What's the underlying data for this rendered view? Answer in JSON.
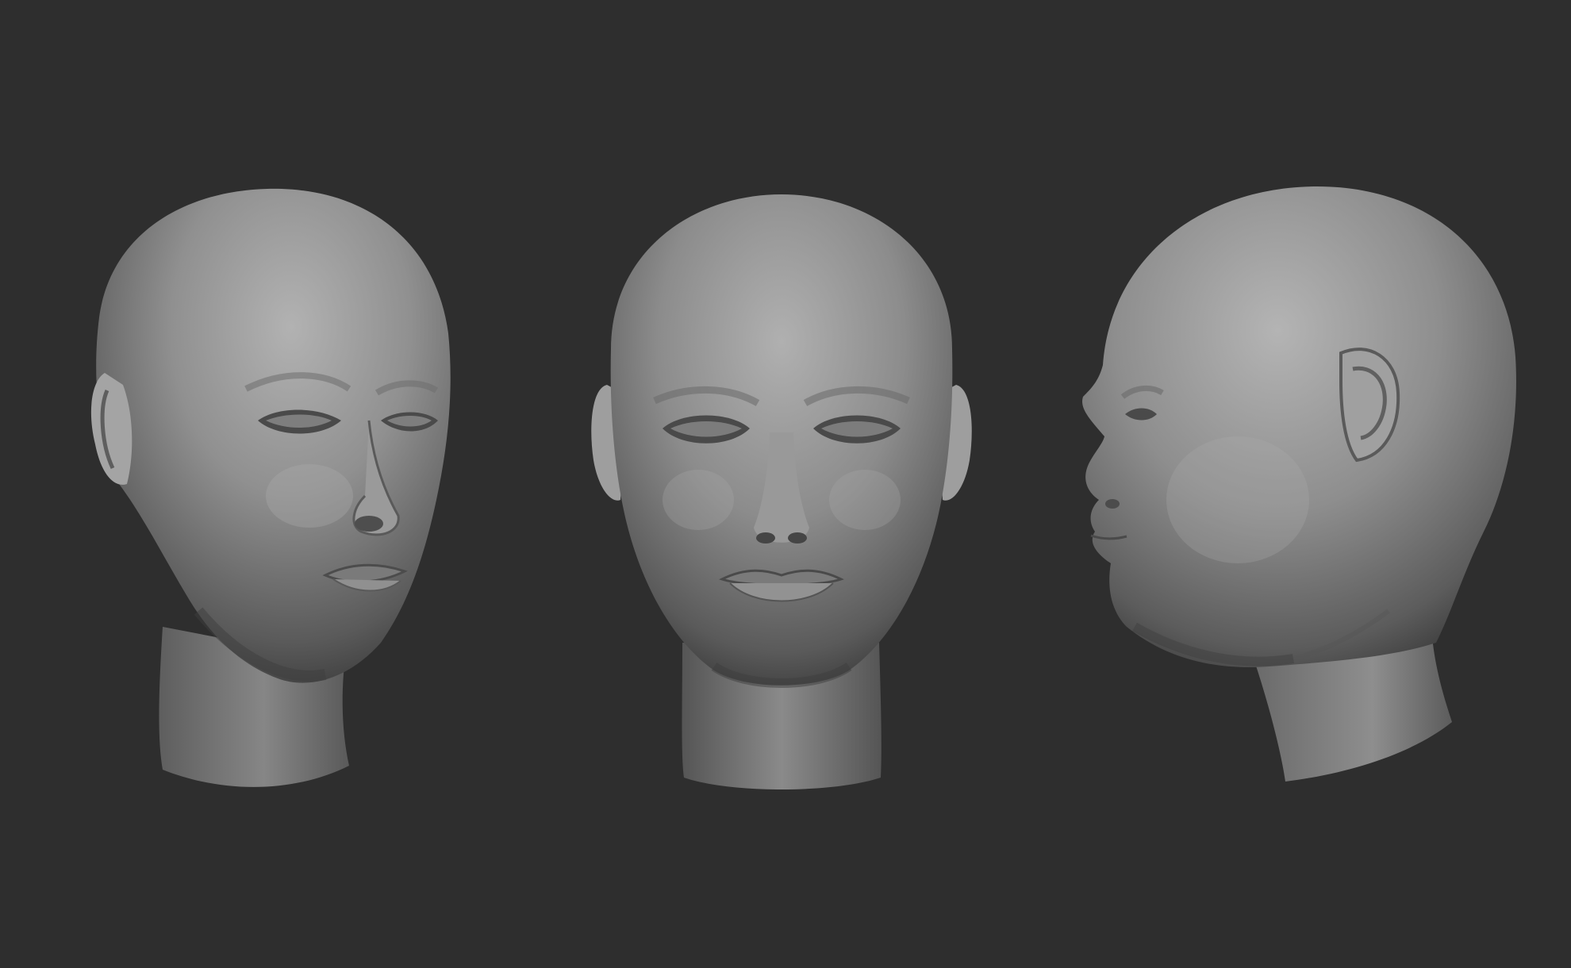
{
  "scene": {
    "background_color": "#2e2e2e",
    "model_base_color": "#8a8a8a",
    "model_highlight_color": "#b4b4b4",
    "model_shadow_color": "#3c3c3c",
    "views": [
      {
        "id": "three-quarter",
        "icon": "sculpted-head-three-quarter-view"
      },
      {
        "id": "front",
        "icon": "sculpted-head-front-view"
      },
      {
        "id": "profile",
        "icon": "sculpted-head-side-profile-view"
      }
    ]
  }
}
